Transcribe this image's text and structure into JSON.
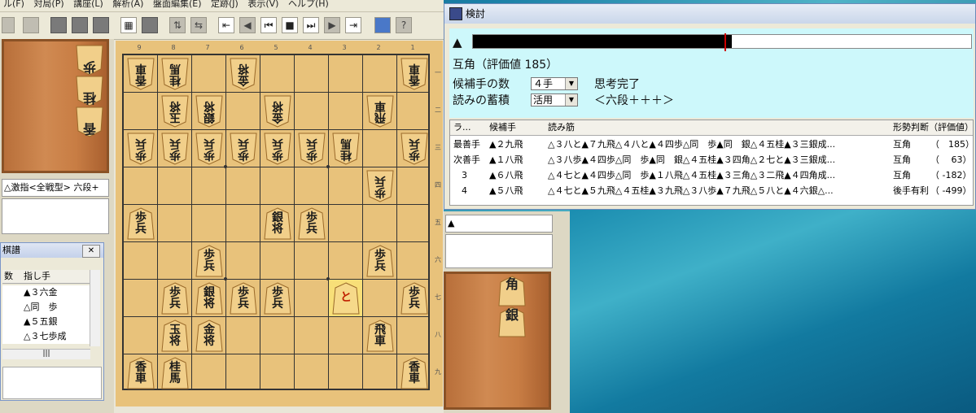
{
  "menu": [
    "ル(F)",
    "対局(P)",
    "講座(L)",
    "解析(A)",
    "盤面編集(E)",
    "定跡(J)",
    "表示(V)",
    "ヘルプ(H)"
  ],
  "colors": {
    "board": "#e8c27b",
    "komadai": "#c8803f",
    "eval_bg": "#cdf8fb",
    "highlight": "#ffe878"
  },
  "left_info": "△激指<全戦型> 六段+",
  "kifu": {
    "title": "棋譜",
    "close": "✕",
    "header_num": "数",
    "header_move": "指し手",
    "moves": [
      "▲３六金",
      "△同　歩",
      "▲５五銀",
      "△３七歩成"
    ],
    "hscroll": "|||"
  },
  "gote_hand": [
    "歩",
    "桂",
    "香"
  ],
  "sente_hand": [
    "角",
    "銀"
  ],
  "file_labels": [
    "9",
    "8",
    "7",
    "6",
    "5",
    "4",
    "3",
    "2",
    "1"
  ],
  "rank_labels": [
    "一",
    "二",
    "三",
    "四",
    "五",
    "六",
    "七",
    "八",
    "九"
  ],
  "board_pieces": [
    {
      "col": 0,
      "row": 0,
      "gote": true,
      "t1": "香",
      "t2": "車"
    },
    {
      "col": 1,
      "row": 0,
      "gote": true,
      "t1": "桂",
      "t2": "馬"
    },
    {
      "col": 3,
      "row": 0,
      "gote": true,
      "t1": "金",
      "t2": "将"
    },
    {
      "col": 8,
      "row": 0,
      "gote": true,
      "t1": "香",
      "t2": "車"
    },
    {
      "col": 1,
      "row": 1,
      "gote": true,
      "t1": "玉",
      "t2": "将"
    },
    {
      "col": 2,
      "row": 1,
      "gote": true,
      "t1": "銀",
      "t2": "将"
    },
    {
      "col": 4,
      "row": 1,
      "gote": true,
      "t1": "金",
      "t2": "将"
    },
    {
      "col": 7,
      "row": 1,
      "gote": true,
      "t1": "飛",
      "t2": "車"
    },
    {
      "col": 0,
      "row": 2,
      "gote": true,
      "t1": "歩",
      "t2": "兵"
    },
    {
      "col": 1,
      "row": 2,
      "gote": true,
      "t1": "歩",
      "t2": "兵"
    },
    {
      "col": 2,
      "row": 2,
      "gote": true,
      "t1": "歩",
      "t2": "兵"
    },
    {
      "col": 3,
      "row": 2,
      "gote": true,
      "t1": "歩",
      "t2": "兵"
    },
    {
      "col": 4,
      "row": 2,
      "gote": true,
      "t1": "歩",
      "t2": "兵"
    },
    {
      "col": 5,
      "row": 2,
      "gote": true,
      "t1": "歩",
      "t2": "兵"
    },
    {
      "col": 6,
      "row": 2,
      "gote": true,
      "t1": "桂",
      "t2": "馬"
    },
    {
      "col": 8,
      "row": 2,
      "gote": true,
      "t1": "歩",
      "t2": "兵"
    },
    {
      "col": 7,
      "row": 3,
      "gote": true,
      "t1": "歩",
      "t2": "兵"
    },
    {
      "col": 0,
      "row": 4,
      "gote": false,
      "t1": "歩",
      "t2": "兵"
    },
    {
      "col": 4,
      "row": 4,
      "gote": false,
      "t1": "銀",
      "t2": "将"
    },
    {
      "col": 5,
      "row": 4,
      "gote": false,
      "t1": "歩",
      "t2": "兵"
    },
    {
      "col": 2,
      "row": 5,
      "gote": false,
      "t1": "歩",
      "t2": "兵"
    },
    {
      "col": 7,
      "row": 5,
      "gote": false,
      "t1": "歩",
      "t2": "兵"
    },
    {
      "col": 1,
      "row": 6,
      "gote": false,
      "t1": "歩",
      "t2": "兵"
    },
    {
      "col": 2,
      "row": 6,
      "gote": false,
      "t1": "銀",
      "t2": "将"
    },
    {
      "col": 3,
      "row": 6,
      "gote": false,
      "t1": "歩",
      "t2": "兵"
    },
    {
      "col": 4,
      "row": 6,
      "gote": false,
      "t1": "歩",
      "t2": "兵"
    },
    {
      "col": 6,
      "row": 6,
      "gote": false,
      "t1": "と",
      "t2": "",
      "red": true
    },
    {
      "col": 8,
      "row": 6,
      "gote": false,
      "t1": "歩",
      "t2": "兵"
    },
    {
      "col": 1,
      "row": 7,
      "gote": false,
      "t1": "玉",
      "t2": "将"
    },
    {
      "col": 2,
      "row": 7,
      "gote": false,
      "t1": "金",
      "t2": "将"
    },
    {
      "col": 7,
      "row": 7,
      "gote": false,
      "t1": "飛",
      "t2": "車"
    },
    {
      "col": 0,
      "row": 8,
      "gote": false,
      "t1": "香",
      "t2": "車"
    },
    {
      "col": 1,
      "row": 8,
      "gote": false,
      "t1": "桂",
      "t2": "馬"
    },
    {
      "col": 8,
      "row": 8,
      "gote": false,
      "t1": "香",
      "t2": "車"
    }
  ],
  "kentou": {
    "title": "検討",
    "eval_marker": "▲",
    "eval_ratio": 0.52,
    "eval_text": "互角（評価値 185）",
    "cand_label": "候補手の数",
    "cand_value": "４手",
    "status": "思考完了",
    "accum_label": "読みの蓄積",
    "accum_value": "活用",
    "rank_text": "＜六段＋＋＋＞",
    "headers": {
      "rank": "ラ...",
      "move": "候補手",
      "pv": "読み筋",
      "judge": "形勢判断（評価値）"
    },
    "rows": [
      {
        "rank": "最善手",
        "move": "▲２九飛",
        "pv": "△３八と▲７九飛△４八と▲４四歩△同　歩▲同　銀△４五桂▲３三銀成...",
        "judge": "互角",
        "val": "（　185）"
      },
      {
        "rank": "次善手",
        "move": "▲１八飛",
        "pv": "△３八歩▲４四歩△同　歩▲同　銀△４五桂▲３四角△２七と▲３三銀成...",
        "judge": "互角",
        "val": "（　 63）"
      },
      {
        "rank": "3",
        "move": "▲６八飛",
        "pv": "△４七と▲４四歩△同　歩▲１八飛△４五桂▲３三角△３二飛▲４四角成...",
        "judge": "互角",
        "val": "（ -182）"
      },
      {
        "rank": "4",
        "move": "▲５八飛",
        "pv": "△４七と▲５九飛△４五桂▲３九飛△３八歩▲７九飛△５八と▲４六銀△...",
        "judge": "後手有利",
        "val": "（ -499）"
      }
    ]
  },
  "right_info": "▲"
}
